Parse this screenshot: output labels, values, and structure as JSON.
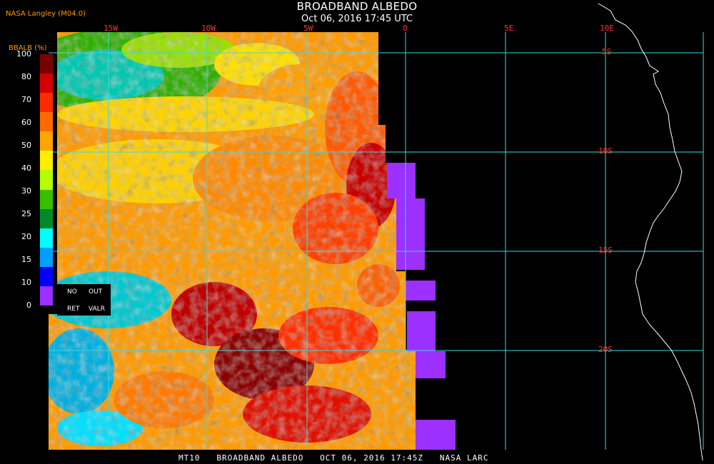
{
  "header": {
    "title": "BROADBAND ALBEDO",
    "subtitle": "Oct 06, 2016 17:45 UTC",
    "source": "NASA Langley (M04.0)"
  },
  "footer": "MT10   BROADBAND ALBEDO   OCT 06, 2016 17:45Z   NASA LARC",
  "grid": {
    "lon_labels": [
      "15W",
      "10W",
      "5W",
      "0",
      "5E",
      "10E"
    ],
    "lat_labels": [
      "5S",
      "10S",
      "15S",
      "20S"
    ],
    "color": "#40d8d8",
    "label_color": "#ff3030"
  },
  "colorbar": {
    "title": "BBALB (%)",
    "ticks": [
      "100",
      "80",
      "70",
      "60",
      "50",
      "40",
      "30",
      "25",
      "20",
      "15",
      "10",
      "0"
    ],
    "colors": [
      "#7a0000",
      "#d40000",
      "#ff2a00",
      "#ff6a00",
      "#ffa500",
      "#ffee00",
      "#b4ff00",
      "#36c000",
      "#008a2a",
      "#00ffff",
      "#00a0ff",
      "#0000ff",
      "#9b30ff"
    ],
    "nodata_labels": [
      "NO",
      "OUT",
      "RET",
      "VALR"
    ]
  },
  "palette": {
    "coast": "#ffffff",
    "nodata": "#9b30ff",
    "background": "#000000"
  }
}
